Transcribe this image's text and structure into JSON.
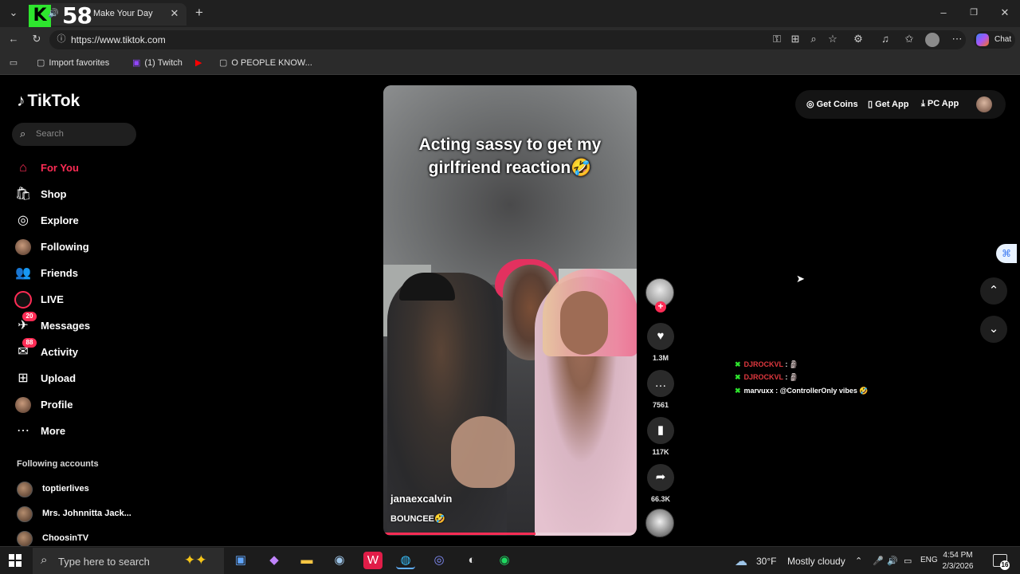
{
  "browser": {
    "overlay_badge": "K",
    "overlay_number": "58",
    "tab_title": "Make Your Day",
    "url": "https://www.tiktok.com",
    "chat_label": "Chat",
    "favorites": [
      {
        "label": "Import favorites",
        "icon": "import-icon"
      },
      {
        "label": "(1) Twitch",
        "icon": "twitch-icon"
      },
      {
        "label": "",
        "icon": "youtube-icon"
      },
      {
        "label": "O PEOPLE KNOW...",
        "icon": "page-icon"
      }
    ]
  },
  "tiktok": {
    "logo": "TikTok",
    "search_placeholder": "Search",
    "nav": [
      {
        "label": "For You",
        "icon": "home-icon",
        "glyph": "⌂",
        "active": true,
        "badge": ""
      },
      {
        "label": "Shop",
        "icon": "shop-icon",
        "glyph": "🛍",
        "active": false,
        "badge": ""
      },
      {
        "label": "Explore",
        "icon": "compass-icon",
        "glyph": "◎",
        "active": false,
        "badge": ""
      },
      {
        "label": "Following",
        "icon": "following-avatar-icon",
        "glyph": "●",
        "active": false,
        "badge": ""
      },
      {
        "label": "Friends",
        "icon": "friends-icon",
        "glyph": "👥",
        "active": false,
        "badge": ""
      },
      {
        "label": "LIVE",
        "icon": "live-icon",
        "glyph": "◉",
        "active": false,
        "badge": ""
      },
      {
        "label": "Messages",
        "icon": "messages-icon",
        "glyph": "✈",
        "active": false,
        "badge": "20"
      },
      {
        "label": "Activity",
        "icon": "activity-icon",
        "glyph": "✉",
        "active": false,
        "badge": "88"
      },
      {
        "label": "Upload",
        "icon": "upload-icon",
        "glyph": "⊞",
        "active": false,
        "badge": ""
      },
      {
        "label": "Profile",
        "icon": "profile-avatar-icon",
        "glyph": "●",
        "active": false,
        "badge": ""
      },
      {
        "label": "More",
        "icon": "more-icon",
        "glyph": "⋯",
        "active": false,
        "badge": ""
      }
    ],
    "following_title": "Following accounts",
    "following_accounts": [
      "toptierlives",
      "Mrs. Johnnitta Jack...",
      "ChoosinTV"
    ],
    "topbar": {
      "get_coins": "Get Coins",
      "get_app": "Get App",
      "pc_app": "PC App"
    },
    "video": {
      "caption": "Acting sassy to get my girlfriend reaction🤣",
      "author": "janaexcalvin",
      "description": "BOUNCEE🤣",
      "progress": 0.6
    },
    "actions": {
      "likes": "1.3M",
      "comments": "7561",
      "saves": "117K",
      "shares": "66.3K"
    },
    "chat_overlay": [
      {
        "user": "DJROCKVL",
        "message": "🗿",
        "color": "#e0383e"
      },
      {
        "user": "DJROCKVL",
        "message": "🗿",
        "color": "#e0383e"
      },
      {
        "user": "marvuxx",
        "message": "@ControllerOnly vibes 🤣",
        "color": "#ffffff"
      }
    ]
  },
  "taskbar": {
    "search_placeholder": "Type here to search",
    "weather_temp": "30°F",
    "weather_desc": "Mostly cloudy",
    "lang": "ENG",
    "time": "4:54 PM",
    "date": "2/3/2026",
    "notifications": "16"
  },
  "colors": {
    "accent": "#fe2c55",
    "overlay_green": "#2ee52e"
  }
}
